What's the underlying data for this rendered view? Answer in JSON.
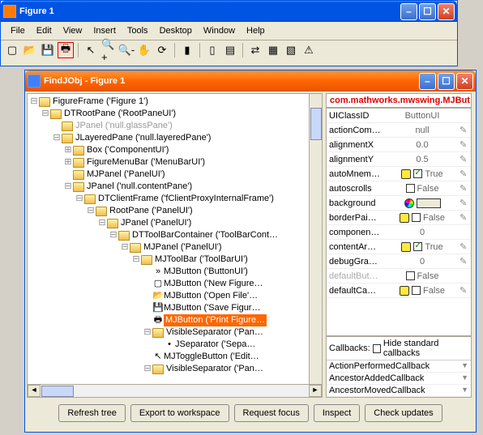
{
  "figure_window": {
    "title": "Figure 1",
    "menus": [
      "File",
      "Edit",
      "View",
      "Insert",
      "Tools",
      "Desktop",
      "Window",
      "Help"
    ],
    "toolbar": [
      {
        "name": "new-figure-icon",
        "glyph": "▢"
      },
      {
        "name": "open-file-icon",
        "glyph": "📂"
      },
      {
        "name": "save-icon",
        "glyph": "💾"
      },
      {
        "name": "print-icon",
        "glyph": "🖶",
        "selected": true
      },
      {
        "name": "sep"
      },
      {
        "name": "pointer-icon",
        "glyph": "↖"
      },
      {
        "name": "zoom-in-icon",
        "glyph": "🔍+"
      },
      {
        "name": "zoom-out-icon",
        "glyph": "🔍-"
      },
      {
        "name": "pan-icon",
        "glyph": "✋"
      },
      {
        "name": "rotate-icon",
        "glyph": "⟳"
      },
      {
        "name": "sep"
      },
      {
        "name": "data-cursor-icon",
        "glyph": "▮"
      },
      {
        "name": "sep"
      },
      {
        "name": "colorbar-icon",
        "glyph": "▯"
      },
      {
        "name": "legend-icon",
        "glyph": "▤"
      },
      {
        "name": "sep"
      },
      {
        "name": "link-icon",
        "glyph": "⇄"
      },
      {
        "name": "plot-tools-icon",
        "glyph": "▦"
      },
      {
        "name": "hide-tools-icon",
        "glyph": "▧"
      },
      {
        "name": "warning-icon",
        "glyph": "⚠"
      }
    ]
  },
  "findjobj_window": {
    "title": "FindJObj - Figure 1",
    "class_header": "com.mathworks.mwswing.MJBut…",
    "tree": [
      {
        "indent": 0,
        "tw": "⊟",
        "icon": "fold",
        "label": "FigureFrame ('Figure 1')"
      },
      {
        "indent": 1,
        "tw": "⊟",
        "icon": "fold",
        "label": "DTRootPane ('RootPaneUI')"
      },
      {
        "indent": 2,
        "tw": " ",
        "icon": "fold",
        "label": "JPanel ('null.glassPane')",
        "gray": true
      },
      {
        "indent": 2,
        "tw": "⊟",
        "icon": "fold",
        "label": "JLayeredPane ('null.layeredPane')"
      },
      {
        "indent": 3,
        "tw": "⊞",
        "icon": "fold",
        "label": "Box ('ComponentUI')"
      },
      {
        "indent": 3,
        "tw": "⊞",
        "icon": "fold",
        "label": "FigureMenuBar ('MenuBarUI')"
      },
      {
        "indent": 3,
        "tw": " ",
        "icon": "fold",
        "label": "MJPanel ('PanelUI')"
      },
      {
        "indent": 3,
        "tw": "⊟",
        "icon": "fold",
        "label": "JPanel ('null.contentPane')"
      },
      {
        "indent": 4,
        "tw": "⊟",
        "icon": "fold",
        "label": "DTClientFrame ('fClientProxyInternalFrame')"
      },
      {
        "indent": 5,
        "tw": "⊟",
        "icon": "fold",
        "label": "RootPane ('PanelUI')"
      },
      {
        "indent": 6,
        "tw": "⊟",
        "icon": "fold",
        "label": "JPanel ('PanelUI')"
      },
      {
        "indent": 7,
        "tw": "⊟",
        "icon": "fold",
        "label": "DTToolBarContainer ('ToolBarCont…"
      },
      {
        "indent": 8,
        "tw": "⊟",
        "icon": "fold",
        "label": "MJPanel ('PanelUI')"
      },
      {
        "indent": 9,
        "tw": "⊟",
        "icon": "fold",
        "label": "MJToolBar ('ToolBarUI')"
      },
      {
        "indent": 10,
        "tw": " ",
        "icon": "leaf",
        "label": "MJButton ('ButtonUI')",
        "leaficon": "»"
      },
      {
        "indent": 10,
        "tw": " ",
        "icon": "leaf",
        "label": "MJButton ('New Figure…",
        "leaficon": "▢"
      },
      {
        "indent": 10,
        "tw": " ",
        "icon": "leaf",
        "label": "MJButton ('Open File'…",
        "leaficon": "📂"
      },
      {
        "indent": 10,
        "tw": " ",
        "icon": "leaf",
        "label": "MJButton ('Save Figur…",
        "leaficon": "💾"
      },
      {
        "indent": 10,
        "tw": " ",
        "icon": "leaf",
        "label": "MJButton ('Print Figure…",
        "leaficon": "🖶",
        "selected": true
      },
      {
        "indent": 10,
        "tw": "⊟",
        "icon": "fold",
        "label": "VisibleSeparator ('Pan…"
      },
      {
        "indent": 11,
        "tw": " ",
        "icon": "leaf",
        "label": "JSeparator ('Sepa…"
      },
      {
        "indent": 10,
        "tw": " ",
        "icon": "leaf",
        "label": "MJToggleButton ('Edit…",
        "leaficon": "↖"
      },
      {
        "indent": 10,
        "tw": "⊟",
        "icon": "fold",
        "label": "VisibleSeparator ('Pan…"
      }
    ],
    "properties": [
      {
        "name": "UIClassID",
        "value": "ButtonUI",
        "edit": false,
        "icon": ""
      },
      {
        "name": "actionCom…",
        "value": "null",
        "edit": true,
        "icon": ""
      },
      {
        "name": "alignmentX",
        "value": "0.0",
        "edit": true,
        "icon": ""
      },
      {
        "name": "alignmentY",
        "value": "0.5",
        "edit": true,
        "icon": ""
      },
      {
        "name": "autoMnem…",
        "value": "True",
        "edit": true,
        "icon": "bulb",
        "check": true
      },
      {
        "name": "autoscrolls",
        "value": "False",
        "edit": true,
        "icon": "",
        "check": false
      },
      {
        "name": "background",
        "value": "",
        "edit": true,
        "icon": "wheel",
        "color": true
      },
      {
        "name": "borderPai…",
        "value": "False",
        "edit": true,
        "icon": "bulb",
        "check": false
      },
      {
        "name": "componen…",
        "value": "0",
        "edit": false,
        "icon": ""
      },
      {
        "name": "contentAr…",
        "value": "True",
        "edit": true,
        "icon": "bulb",
        "check": true
      },
      {
        "name": "debugGra…",
        "value": "0",
        "edit": true,
        "icon": ""
      },
      {
        "name": "defaultBut…",
        "value": "False",
        "edit": false,
        "icon": "",
        "check": false,
        "gray": true
      },
      {
        "name": "defaultCa…",
        "value": "False",
        "edit": true,
        "icon": "bulb",
        "check": false
      }
    ],
    "callbacks_header": "Callbacks:",
    "callbacks_hide_label": "Hide standard callbacks",
    "callbacks": [
      "ActionPerformedCallback",
      "AncestorAddedCallback",
      "AncestorMovedCallback"
    ],
    "buttons": [
      "Refresh tree",
      "Export to workspace",
      "Request focus",
      "Inspect",
      "Check updates"
    ]
  }
}
